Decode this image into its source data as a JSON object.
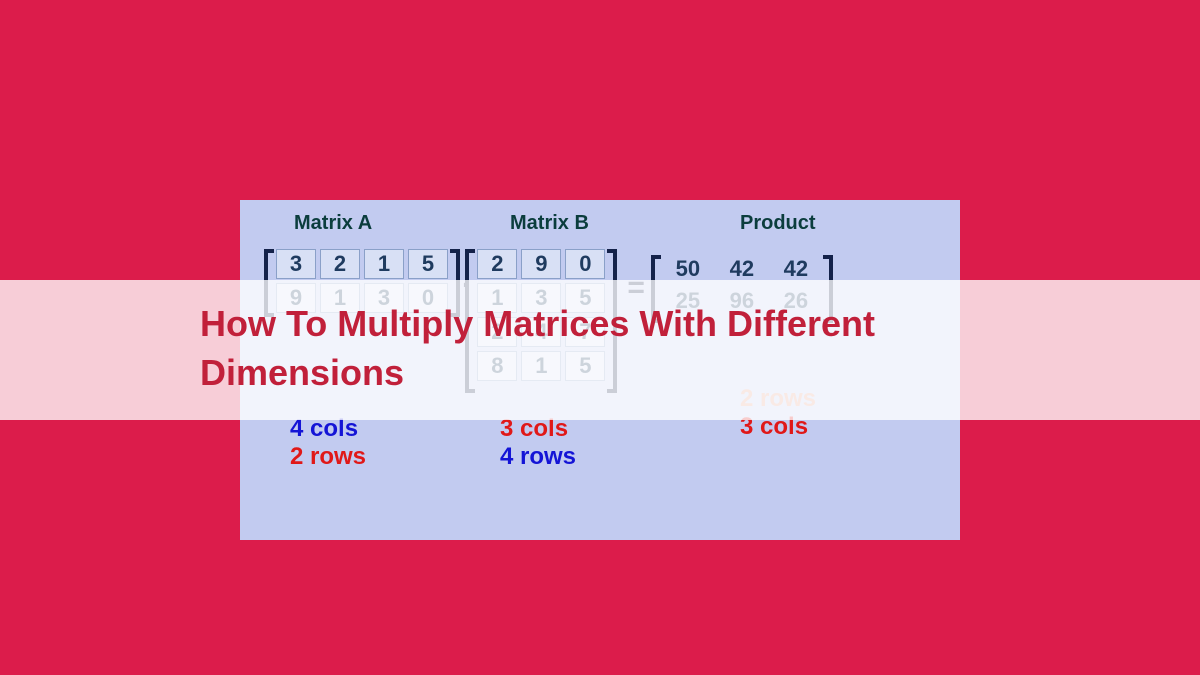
{
  "title": "How To Multiply Matrices With Different Dimensions",
  "headers": {
    "a": "Matrix   A",
    "b": "Matrix B",
    "product": "Product"
  },
  "matrixA": {
    "rows": [
      [
        "3",
        "2",
        "1",
        "5"
      ],
      [
        "9",
        "1",
        "3",
        "0"
      ]
    ],
    "cols_label": "4 cols",
    "rows_label": "2 rows"
  },
  "matrixB": {
    "rows": [
      [
        "2",
        "9",
        "0"
      ],
      [
        "1",
        "3",
        "5"
      ],
      [
        "2",
        "4",
        "7"
      ],
      [
        "8",
        "1",
        "5"
      ]
    ],
    "cols_label": "3  cols",
    "rows_label": "4 rows"
  },
  "product": {
    "rows": [
      [
        "50",
        "42",
        "42"
      ],
      [
        "25",
        "96",
        "26"
      ]
    ],
    "rows_label": "2 rows",
    "cols_label": "3 cols"
  },
  "operators": {
    "dot": "·",
    "equals": "="
  }
}
